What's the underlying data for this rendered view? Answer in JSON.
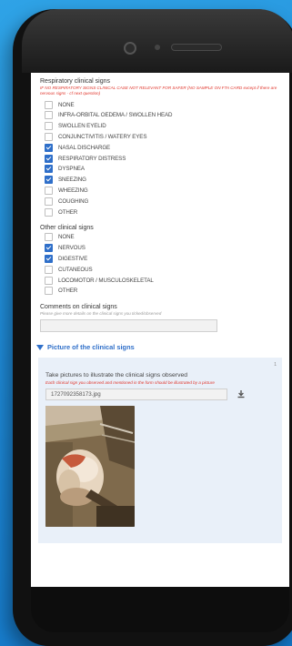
{
  "respiratory": {
    "title": "Respiratory clinical signs",
    "warning": "IF NO RESPIRATORY SIGNS CLINICAL CASE NOT RELEVANT FOR SAFER (NO SAMPLE ON FTA CARD except if there are nervous signs - cf next question)",
    "options": [
      {
        "label": "NONE",
        "checked": false
      },
      {
        "label": "INFRA-ORBITAL OEDEMA / SWOLLEN HEAD",
        "checked": false
      },
      {
        "label": "SWOLLEN EYELID",
        "checked": false
      },
      {
        "label": "CONJUNCTIVITIS / WATERY EYES",
        "checked": false
      },
      {
        "label": "NASAL DISCHARGE",
        "checked": true
      },
      {
        "label": "RESPIRATORY DISTRESS",
        "checked": true
      },
      {
        "label": "DYSPNEA",
        "checked": true
      },
      {
        "label": "SNEEZING",
        "checked": true
      },
      {
        "label": "WHEEZING",
        "checked": false
      },
      {
        "label": "COUGHING",
        "checked": false
      },
      {
        "label": "OTHER",
        "checked": false
      }
    ]
  },
  "other": {
    "title": "Other clinical signs",
    "options": [
      {
        "label": "NONE",
        "checked": false
      },
      {
        "label": "NERVOUS",
        "checked": true
      },
      {
        "label": "DIGESTIVE",
        "checked": true
      },
      {
        "label": "CUTANEOUS",
        "checked": false
      },
      {
        "label": "LOCOMOTOR / MUSCULOSKELETAL",
        "checked": false
      },
      {
        "label": "OTHER",
        "checked": false
      }
    ]
  },
  "comments": {
    "title": "Comments on clinical signs",
    "hint": "Please give more details on the clinical signs you ticked/observed",
    "value": ""
  },
  "picture": {
    "section_title": "Picture of the clinical signs",
    "number": "1",
    "prompt": "Take pictures to illustrate the clinical signs observed",
    "warning": "Each clinical sign you observed and mentioned in the form should be illustrated by a picture",
    "filename": "1727092358173.jpg",
    "download_icon": "download-icon"
  },
  "colors": {
    "accent": "#2f6fc9",
    "warning": "#e0352b"
  }
}
